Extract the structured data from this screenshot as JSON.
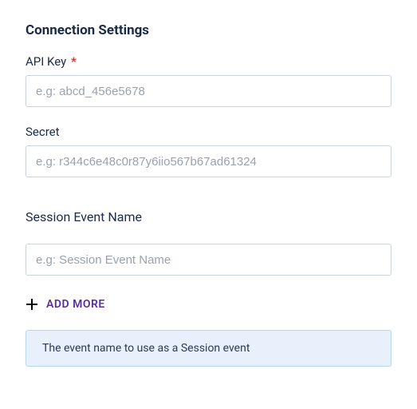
{
  "section": {
    "title": "Connection Settings"
  },
  "fields": {
    "api_key": {
      "label": "API Key",
      "required": true,
      "placeholder": "e.g: abcd_456e5678",
      "value": ""
    },
    "secret": {
      "label": "Secret",
      "required": false,
      "placeholder": "e.g: r344c6e48c0r87y6iio567b67ad61324",
      "value": ""
    }
  },
  "session_event": {
    "heading": "Session Event Name",
    "input": {
      "placeholder": "e.g: Session Event Name",
      "value": ""
    },
    "add_more_label": "ADD MORE",
    "help_text": "The event name to use as a Session event"
  },
  "colors": {
    "text": "#1a2b48",
    "border": "#cdd3dc",
    "required": "#d93025",
    "accent": "#5a2ea0",
    "info_bg": "#e8f1fb",
    "info_border": "#b8d4ee"
  }
}
